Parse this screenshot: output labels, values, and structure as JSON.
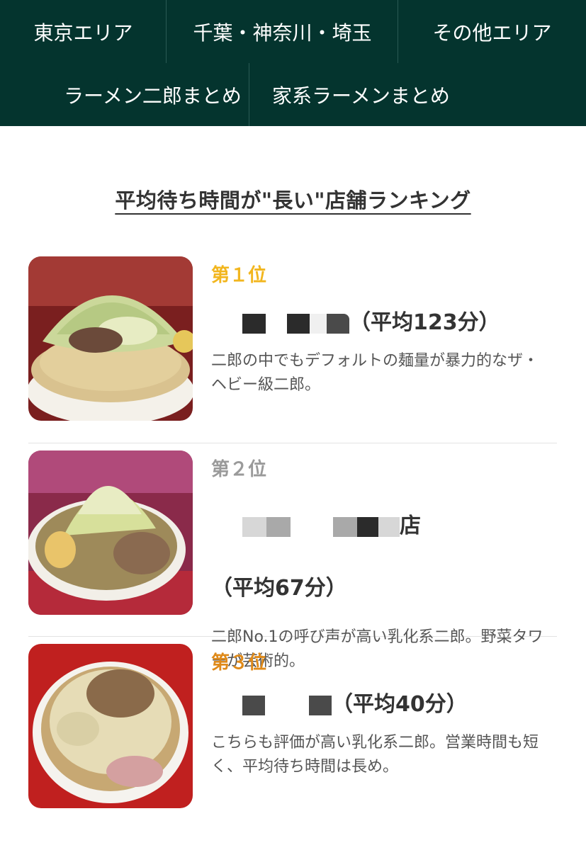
{
  "nav": {
    "row1": [
      "東京エリア",
      "千葉・神奈川・埼玉",
      "その他エリア"
    ],
    "row2": [
      "ラーメン二郎まとめ",
      "家系ラーメンまとめ"
    ]
  },
  "colors": {
    "nav_bg": "#04342e",
    "rank1": "#f2b61e",
    "rank2": "#9a9a9a",
    "rank3": "#df8a1a"
  },
  "section_title": "平均待ち時間が\"長い\"店舗ランキング",
  "ranking": [
    {
      "rank": "第１位",
      "avg": "（平均123分）",
      "desc": "二郎の中でもデフォルトの麺量が暴力的なザ・ヘビー級二郎。"
    },
    {
      "rank": "第２位",
      "name_tail": "店",
      "avg": "（平均67分）",
      "desc": "二郎No.1の呼び声が高い乳化系二郎。野菜タワーが芸術的。"
    },
    {
      "rank": "第３位",
      "avg": "（平均40分）",
      "desc": "こちらも評価が高い乳化系二郎。営業時間も短く、平均待ち時間は長め。"
    }
  ]
}
